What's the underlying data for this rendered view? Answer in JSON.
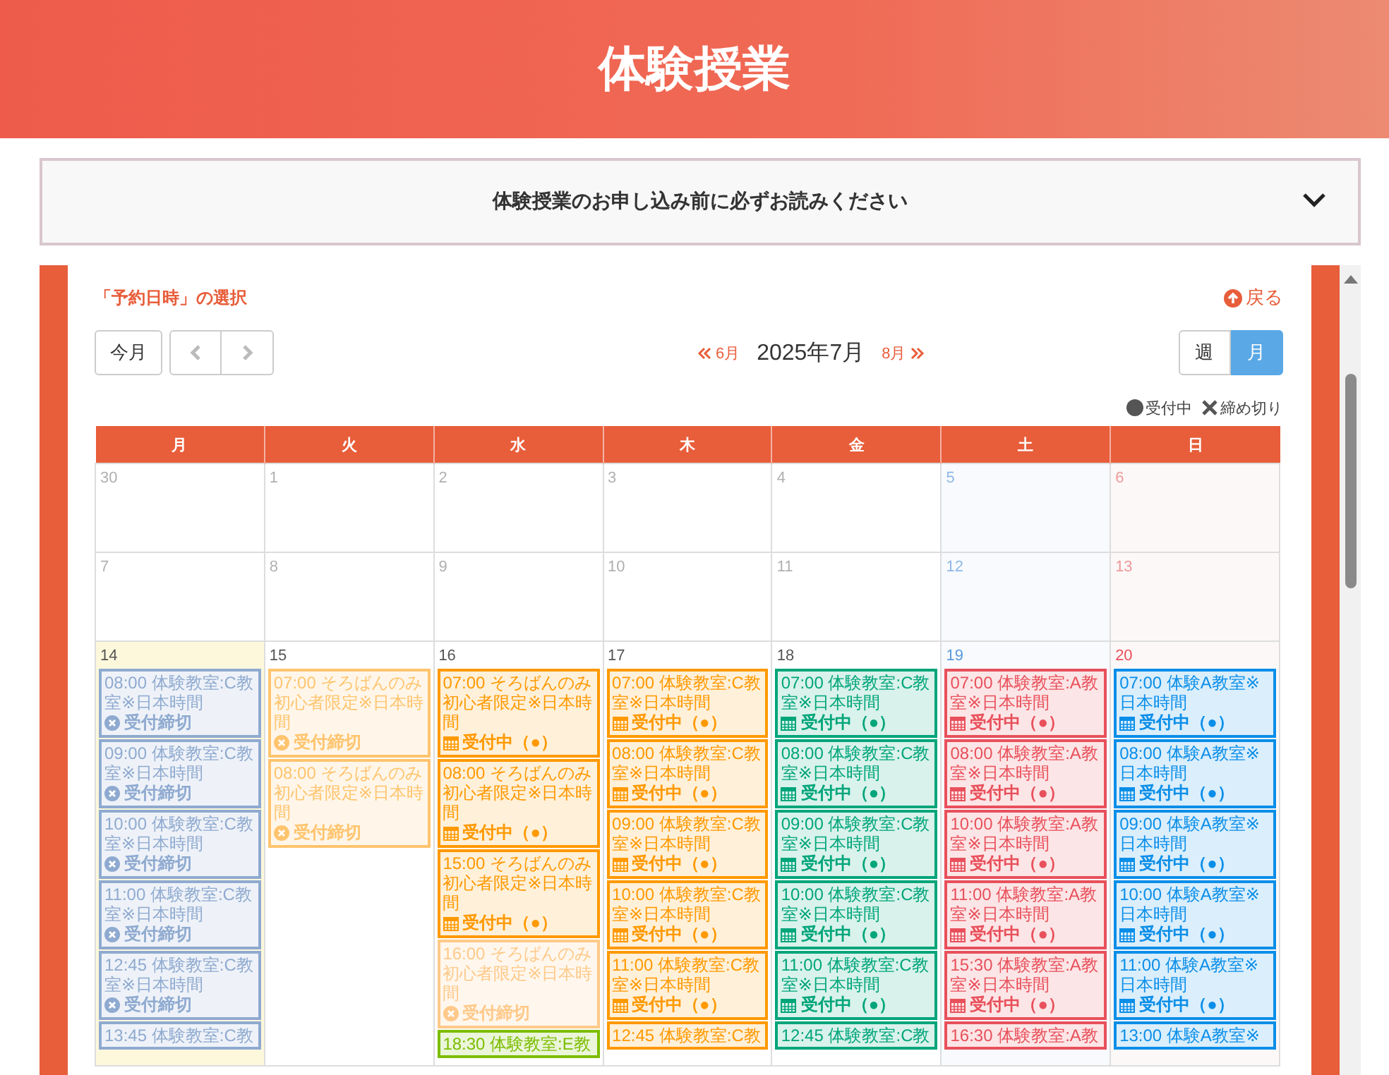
{
  "header": {
    "title": "体験授業"
  },
  "notice": {
    "text": "体験授業のお申し込み前に必ずお読みください",
    "expanded": false
  },
  "calendar": {
    "section_title": "「予約日時」の選択",
    "back_link": "戻る",
    "today_button": "今月",
    "prev_month": "6月",
    "current_month": "2025年7月",
    "next_month": "8月",
    "views": [
      {
        "label": "週",
        "selected": false
      },
      {
        "label": "月",
        "selected": true
      }
    ],
    "legend": [
      {
        "kind": "open",
        "label": "受付中"
      },
      {
        "kind": "closed",
        "label": "締め切り"
      }
    ],
    "weekdays": [
      "月",
      "火",
      "水",
      "木",
      "金",
      "土",
      "日"
    ],
    "weeks": [
      {
        "days": [
          {
            "date": "30",
            "other_month": true,
            "today": false
          },
          {
            "date": "1",
            "other_month": true,
            "today": false
          },
          {
            "date": "2",
            "other_month": true,
            "today": false
          },
          {
            "date": "3",
            "other_month": true,
            "today": false
          },
          {
            "date": "4",
            "other_month": true,
            "today": false
          },
          {
            "date": "5",
            "other_month": true,
            "today": false
          },
          {
            "date": "6",
            "other_month": true,
            "today": false
          }
        ]
      },
      {
        "days": [
          {
            "date": "7",
            "other_month": true,
            "today": false
          },
          {
            "date": "8",
            "other_month": true,
            "today": false
          },
          {
            "date": "9",
            "other_month": true,
            "today": false
          },
          {
            "date": "10",
            "other_month": true,
            "today": false
          },
          {
            "date": "11",
            "other_month": true,
            "today": false
          },
          {
            "date": "12",
            "other_month": true,
            "today": false
          },
          {
            "date": "13",
            "other_month": true,
            "today": false
          }
        ]
      },
      {
        "days": [
          {
            "date": "14",
            "other_month": false,
            "today": true,
            "events": [
              {
                "kind": "closed",
                "color": "#8faad0",
                "title": "08:00 体験教室:C教室※日本時間",
                "status": "受付締切"
              },
              {
                "kind": "closed",
                "color": "#8faad0",
                "title": "09:00 体験教室:C教室※日本時間",
                "status": "受付締切"
              },
              {
                "kind": "closed",
                "color": "#8faad0",
                "title": "10:00 体験教室:C教室※日本時間",
                "status": "受付締切"
              },
              {
                "kind": "closed",
                "color": "#8faad0",
                "title": "11:00 体験教室:C教室※日本時間",
                "status": "受付締切"
              },
              {
                "kind": "closed",
                "color": "#8faad0",
                "title": "12:45 体験教室:C教室※日本時間",
                "status": "受付締切"
              },
              {
                "color": "#8faad0",
                "title": "13:45 体験教室:C教"
              }
            ]
          },
          {
            "date": "15",
            "other_month": false,
            "today": false,
            "events": [
              {
                "kind": "closed",
                "color": "#ffc46e",
                "title": "07:00 そろばんのみ初心者限定※日本時間",
                "status": "受付締切"
              },
              {
                "kind": "closed",
                "color": "#ffc46e",
                "title": "08:00 そろばんのみ初心者限定※日本時間",
                "status": "受付締切"
              }
            ]
          },
          {
            "date": "16",
            "other_month": false,
            "today": false,
            "events": [
              {
                "kind": "open",
                "color": "#ff9900",
                "title": "07:00 そろばんのみ初心者限定※日本時間",
                "status": "受付中（●）"
              },
              {
                "kind": "open",
                "color": "#ff9900",
                "title": "08:00 そろばんのみ初心者限定※日本時間",
                "status": "受付中（●）"
              },
              {
                "kind": "open",
                "color": "#ff9900",
                "title": "15:00 そろばんのみ初心者限定※日本時間",
                "status": "受付中（●）"
              },
              {
                "kind": "closed",
                "color": "#ffc98a",
                "title": "16:00 そろばんのみ初心者限定※日本時間",
                "status": "受付締切"
              },
              {
                "color": "#7cbd00",
                "title": "18:30 体験教室:E教"
              }
            ]
          },
          {
            "date": "17",
            "other_month": false,
            "today": false,
            "events": [
              {
                "kind": "open",
                "color": "#ff9900",
                "title": "07:00 体験教室:C教室※日本時間",
                "status": "受付中（●）"
              },
              {
                "kind": "open",
                "color": "#ff9900",
                "title": "08:00 体験教室:C教室※日本時間",
                "status": "受付中（●）"
              },
              {
                "kind": "open",
                "color": "#ff9900",
                "title": "09:00 体験教室:C教室※日本時間",
                "status": "受付中（●）"
              },
              {
                "kind": "open",
                "color": "#ff9900",
                "title": "10:00 体験教室:C教室※日本時間",
                "status": "受付中（●）"
              },
              {
                "kind": "open",
                "color": "#ff9900",
                "title": "11:00 体験教室:C教室※日本時間",
                "status": "受付中（●）"
              },
              {
                "color": "#ff9900",
                "title": "12:45 体験教室:C教"
              }
            ]
          },
          {
            "date": "18",
            "other_month": false,
            "today": false,
            "events": [
              {
                "kind": "open",
                "color": "#00a57a",
                "title": "07:00 体験教室:C教室※日本時間",
                "status": "受付中（●）"
              },
              {
                "kind": "open",
                "color": "#00a57a",
                "title": "08:00 体験教室:C教室※日本時間",
                "status": "受付中（●）"
              },
              {
                "kind": "open",
                "color": "#00a57a",
                "title": "09:00 体験教室:C教室※日本時間",
                "status": "受付中（●）"
              },
              {
                "kind": "open",
                "color": "#00a57a",
                "title": "10:00 体験教室:C教室※日本時間",
                "status": "受付中（●）"
              },
              {
                "kind": "open",
                "color": "#00a57a",
                "title": "11:00 体験教室:C教室※日本時間",
                "status": "受付中（●）"
              },
              {
                "color": "#00a57a",
                "title": "12:45 体験教室:C教"
              }
            ]
          },
          {
            "date": "19",
            "other_month": false,
            "today": false,
            "events": [
              {
                "kind": "open",
                "color": "#e8505b",
                "title": "07:00 体験教室:A教室※日本時間",
                "status": "受付中（●）"
              },
              {
                "kind": "open",
                "color": "#e8505b",
                "title": "08:00 体験教室:A教室※日本時間",
                "status": "受付中（●）"
              },
              {
                "kind": "open",
                "color": "#e8505b",
                "title": "10:00 体験教室:A教室※日本時間",
                "status": "受付中（●）"
              },
              {
                "kind": "open",
                "color": "#e8505b",
                "title": "11:00 体験教室:A教室※日本時間",
                "status": "受付中（●）"
              },
              {
                "kind": "open",
                "color": "#e8505b",
                "title": "15:30 体験教室:A教室※日本時間",
                "status": "受付中（●）"
              },
              {
                "color": "#e8505b",
                "title": "16:30 体験教室:A教"
              }
            ]
          },
          {
            "date": "20",
            "other_month": false,
            "today": false,
            "events": [
              {
                "kind": "open",
                "color": "#0a8ee8",
                "title": "07:00 体験A教室※日本時間",
                "status": "受付中（●）"
              },
              {
                "kind": "open",
                "color": "#0a8ee8",
                "title": "08:00 体験A教室※日本時間",
                "status": "受付中（●）"
              },
              {
                "kind": "open",
                "color": "#0a8ee8",
                "title": "09:00 体験A教室※日本時間",
                "status": "受付中（●）"
              },
              {
                "kind": "open",
                "color": "#0a8ee8",
                "title": "10:00 体験A教室※日本時間",
                "status": "受付中（●）"
              },
              {
                "kind": "open",
                "color": "#0a8ee8",
                "title": "11:00 体験A教室※日本時間",
                "status": "受付中（●）"
              },
              {
                "color": "#0a8ee8",
                "title": "13:00 体験A教室※"
              }
            ]
          }
        ]
      }
    ]
  }
}
